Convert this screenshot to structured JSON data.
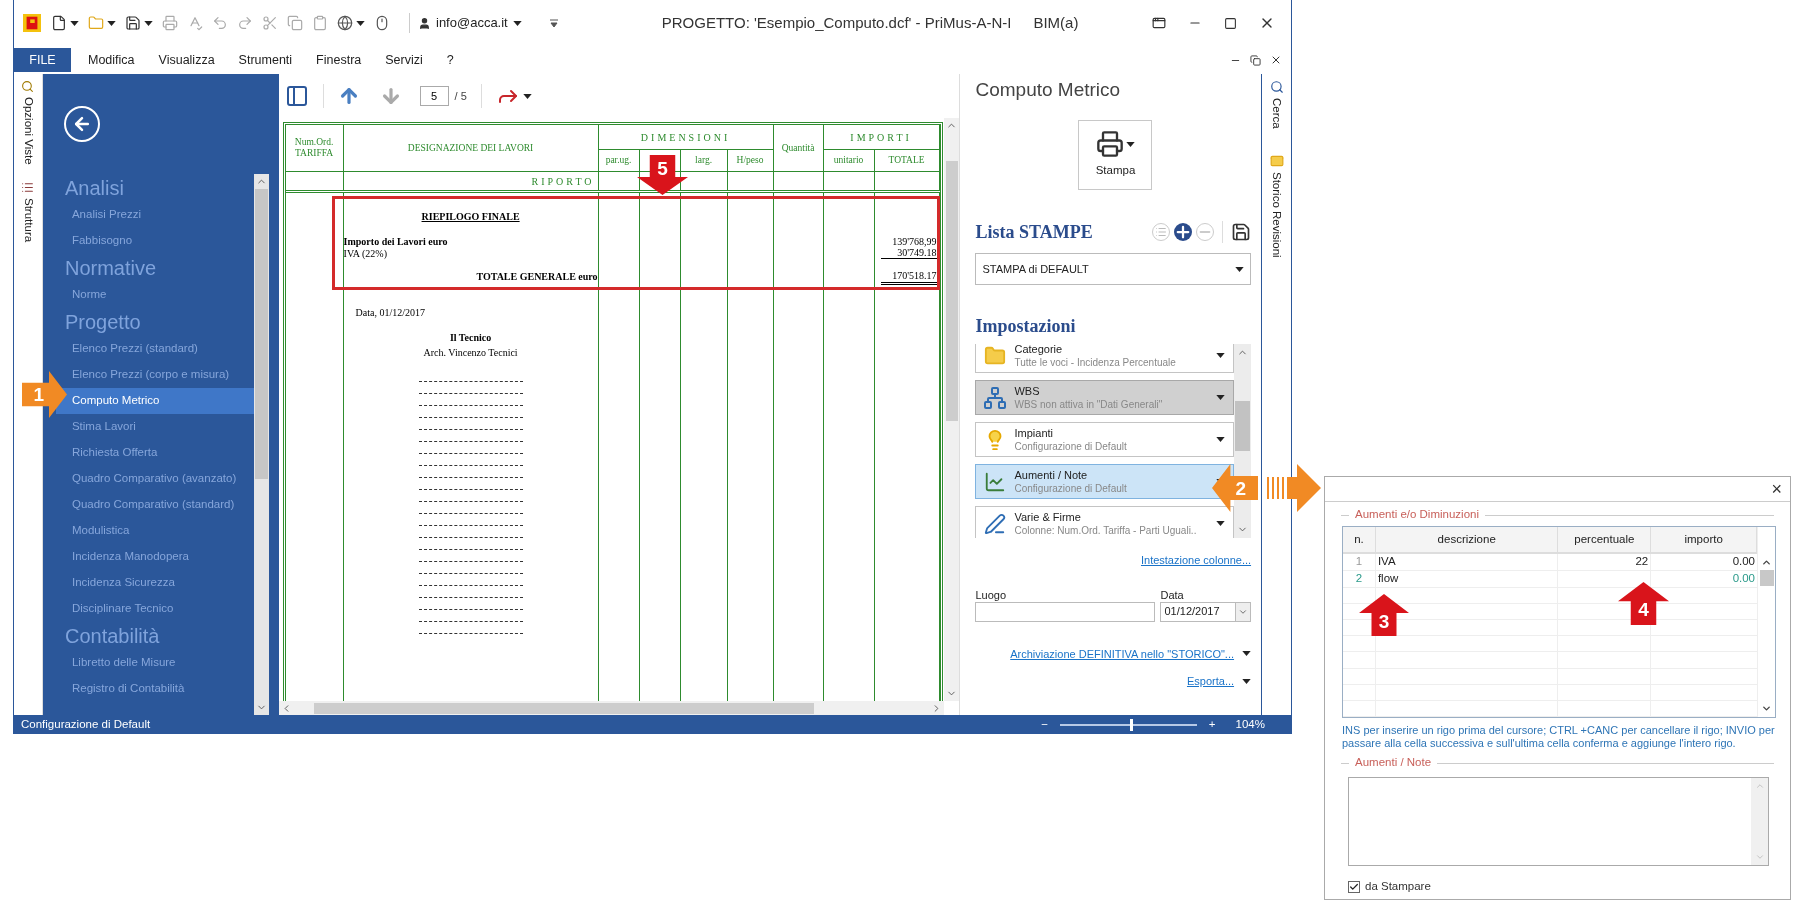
{
  "title_bar": {
    "user": "info@acca.it",
    "title": "PROGETTO: 'Esempio_Computo.dcf' - PriMus-A-N-I",
    "suffix": "BIM(a)"
  },
  "menu": [
    {
      "label": "FILE",
      "kind": "file"
    },
    {
      "label": "Modifica",
      "kind": "menu"
    },
    {
      "label": "Visualizza",
      "kind": "menu"
    },
    {
      "label": "Strumenti",
      "kind": "menu"
    },
    {
      "label": "Finestra",
      "kind": "menu"
    },
    {
      "label": "Servizi",
      "kind": "menu"
    },
    {
      "label": "?",
      "kind": "menu"
    }
  ],
  "left_tabs": [
    "Opzioni Viste",
    "Struttura"
  ],
  "sidebar": {
    "sections": [
      {
        "title": "Analisi",
        "items": [
          {
            "label": "Analisi Prezzi",
            "selected": false
          },
          {
            "label": "Fabbisogno",
            "selected": false
          }
        ]
      },
      {
        "title": "Normative",
        "items": [
          {
            "label": "Norme",
            "selected": false
          }
        ]
      },
      {
        "title": "Progetto",
        "items": [
          {
            "label": "Elenco Prezzi (standard)",
            "selected": false
          },
          {
            "label": "Elenco Prezzi (corpo e misura)",
            "selected": false
          },
          {
            "label": "Computo Metrico",
            "selected": true
          },
          {
            "label": "Stima Lavori",
            "selected": false
          },
          {
            "label": "Richiesta Offerta",
            "selected": false
          },
          {
            "label": "Quadro Comparativo (avanzato)",
            "selected": false
          },
          {
            "label": "Quadro Comparativo (standard)",
            "selected": false
          },
          {
            "label": "Modulistica",
            "selected": false
          },
          {
            "label": "Incidenza Manodopera",
            "selected": false
          },
          {
            "label": "Incidenza Sicurezza",
            "selected": false
          },
          {
            "label": "Disciplinare Tecnico",
            "selected": false
          }
        ]
      },
      {
        "title": "Contabilità",
        "items": [
          {
            "label": "Libretto delle Misure",
            "selected": false
          },
          {
            "label": "Registro di Contabilità",
            "selected": false
          }
        ]
      }
    ]
  },
  "toolbar": {
    "page": "5",
    "total": "/ 5"
  },
  "document": {
    "header": {
      "num": [
        "Num.Ord.",
        "TARIFFA"
      ],
      "designation": "DESIGNAZIONE DEI LAVORI",
      "dimensions": "DIMENSIONI",
      "dim_cols_left": [
        "par.ug."
      ],
      "dim_cols_right": [
        "larg.",
        "H/peso"
      ],
      "quantity": "Quantità",
      "amounts": "IMPORTI",
      "amount_cols": [
        "unitario",
        "TOTALE"
      ]
    },
    "carry": "RIPORTO",
    "summary": {
      "title": "RIEPILOGO FINALE",
      "lines": [
        {
          "label": "Importo dei Lavori euro",
          "bold": true,
          "amount": "139'768,99"
        },
        {
          "label": "IVA (22%)",
          "bold": false,
          "amount": "30'749.18"
        }
      ],
      "total_label": "TOTALE GENERALE euro",
      "total": "170'518.17"
    },
    "signature": {
      "date": "Data, 01/12/2017",
      "role": "Il Tecnico",
      "name": "Arch. Vincenzo Tecnici"
    }
  },
  "right_panel": {
    "title": "Computo Metrico",
    "print_button": "Stampa",
    "list_title": "Lista STAMPE",
    "list_value": "STAMPA di DEFAULT",
    "settings_title": "Impostazioni",
    "settings": [
      {
        "kind": "folder",
        "title": "Categorie",
        "subtitle": "Tutte le voci - Incidenza Percentuale",
        "selected": false,
        "disabled": false
      },
      {
        "kind": "hierarchy",
        "title": "WBS",
        "subtitle": "WBS non attiva in \"Dati Generali\"",
        "selected": false,
        "disabled": true
      },
      {
        "kind": "lightbulb",
        "title": "Impianti",
        "subtitle": "Configurazione di Default",
        "selected": false,
        "disabled": false
      },
      {
        "kind": "chart",
        "title": "Aumenti / Note",
        "subtitle": "Configurazione di Default",
        "selected": true,
        "disabled": false
      },
      {
        "kind": "pen",
        "title": "Varie & Firme",
        "subtitle": "Colonne: Num.Ord. Tariffa - Parti Uguali..",
        "selected": false,
        "disabled": false
      }
    ],
    "columns_link": "Intestazione colonne...",
    "place_label": "Luogo",
    "date_label": "Data",
    "date": "01/12/2017",
    "archive_link": "Archiviazione DEFINITIVA nello \"STORICO\"...",
    "export_link": "Esporta..."
  },
  "right_tabs": [
    "Cerca",
    "Storico Revisioni"
  ],
  "status_bar": {
    "text": "Configurazione di Default",
    "zoom_out": "−",
    "zoom_in": "+",
    "zoom": "104%",
    "level": 0.52
  },
  "dialog": {
    "close": "×",
    "group1": "Aumenti e/o Diminuzioni",
    "columns": [
      "n.",
      "descrizione",
      "percentuale",
      "importo"
    ],
    "rows": [
      {
        "n": "1",
        "description": "IVA",
        "percent": "22",
        "amount": "0.00",
        "selected": false
      },
      {
        "n": "2",
        "description": "flow",
        "amount": "0.00",
        "selected": true
      }
    ],
    "hint": "INS per inserire un rigo prima del cursore; CTRL +CANC per cancellare il rigo; INVIO per passare alla cella successiva e sull'ultima cella conferma e aggiunge l'intero rigo.",
    "group2": "Aumenti / Note",
    "print_checkbox": {
      "label": "da Stampare",
      "checked": true
    }
  },
  "callouts": [
    {
      "label": "1",
      "kind": "right",
      "color": "#f18a24"
    },
    {
      "label": "2",
      "kind": "left",
      "color": "#f18a24"
    },
    {
      "label": "3",
      "kind": "up",
      "color": "#d9141b"
    },
    {
      "label": "4",
      "kind": "up",
      "color": "#d9141b"
    },
    {
      "label": "5",
      "kind": "down",
      "color": "#d9141b"
    }
  ]
}
